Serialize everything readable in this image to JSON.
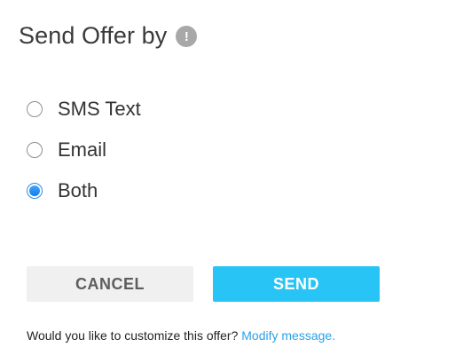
{
  "header": {
    "title": "Send Offer by",
    "info_icon_glyph": "!",
    "info_icon_name": "info-icon"
  },
  "options": [
    {
      "label": "SMS Text",
      "checked": false
    },
    {
      "label": "Email",
      "checked": false
    },
    {
      "label": "Both",
      "checked": true
    }
  ],
  "buttons": {
    "cancel_label": "CANCEL",
    "send_label": "SEND"
  },
  "footer": {
    "prompt": "Would you like to customize this offer?",
    "link_label": "Modify message."
  },
  "colors": {
    "accent": "#27c4f5",
    "link": "#2aa0e8",
    "radio_selected": "#2a8ef0",
    "cancel_bg": "#f0f0f0",
    "info_icon_bg": "#a8a8a8"
  }
}
